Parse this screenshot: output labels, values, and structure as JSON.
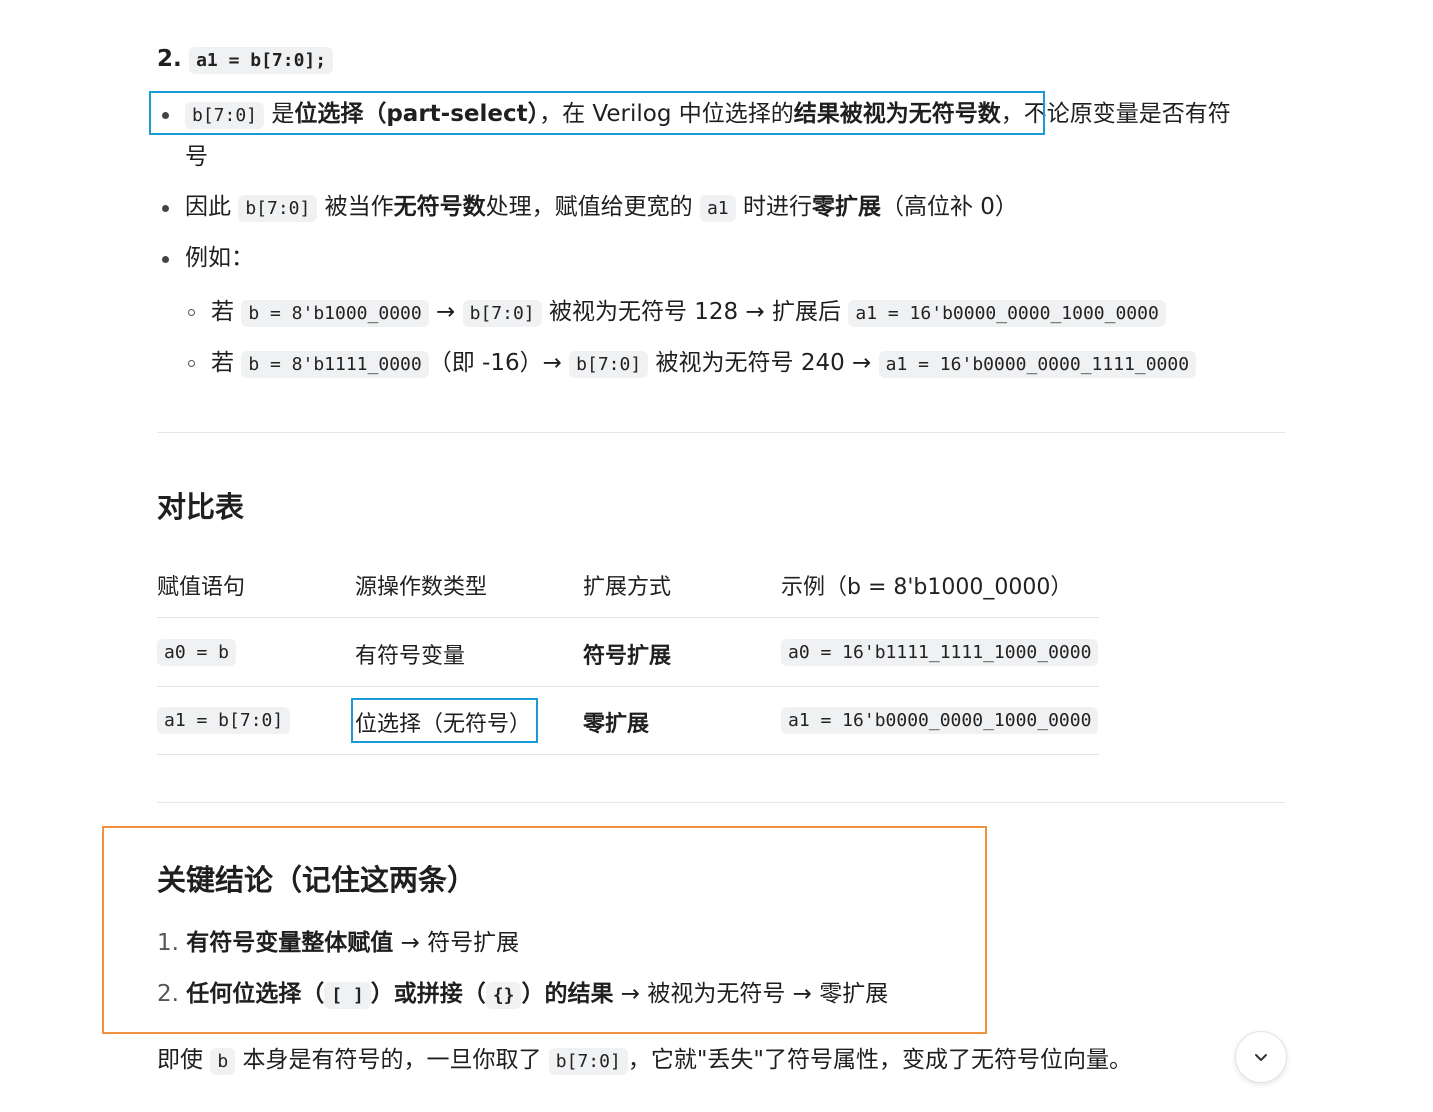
{
  "section_item2": {
    "number": "2.",
    "code": "a1 = b[7:0];"
  },
  "bullet1": {
    "code": "b[7:0]",
    "t1": " 是",
    "b1": "位选择（part-select）",
    "t2": "，在 Verilog 中位选择的",
    "b2": "结果被视为无符号数",
    "t3": "，不论原变量是否有符",
    "t4": "号"
  },
  "bullet2": {
    "t1": "因此 ",
    "code1": "b[7:0]",
    "t2": " 被当作",
    "b1": "无符号数",
    "t3": "处理，赋值给更宽的 ",
    "code2": "a1",
    "t4": " 时进行",
    "b2": "零扩展",
    "t5": "（高位补 0）"
  },
  "bullet3": {
    "label": "例如："
  },
  "sub1": {
    "t1": "若 ",
    "code1": "b = 8'b1000_0000",
    "t2": " → ",
    "code2": "b[7:0]",
    "t3": " 被视为无符号 128 → 扩展后 ",
    "code3": "a1 = 16'b0000_0000_1000_0000"
  },
  "sub2": {
    "t1": "若 ",
    "code1": "b = 8'b1111_0000",
    "t2": "（即 -16）→ ",
    "code2": "b[7:0]",
    "t3": " 被视为无符号 240 → ",
    "code3": "a1 = 16'b0000_0000_1111_0000"
  },
  "table_section": {
    "heading": "对比表",
    "headers": [
      "赋值语句",
      "源操作数类型",
      "扩展方式",
      "示例（b = 8'b1000_0000）"
    ],
    "rows": [
      [
        "a0 = b",
        "有符号变量",
        "符号扩展",
        "a0 = 16'b1111_1111_1000_0000"
      ],
      [
        "a1 = b[7:0]",
        "位选择（无符号）",
        "零扩展",
        "a1 = 16'b0000_0000_1000_0000"
      ]
    ]
  },
  "conclusion": {
    "heading": "关键结论（记住这两条）",
    "item1": {
      "num": "1.",
      "bold": "有符号变量整体赋值",
      "rest": " → 符号扩展"
    },
    "item2": {
      "num": "2.",
      "b1": "任何位选择（",
      "code1": "[ ]",
      "b2": "）或拼接（",
      "code2": "{}",
      "b3": "）的结果",
      "rest": " → 被视为无符号 → 零扩展"
    }
  },
  "final_line": {
    "t1": "即使 ",
    "code1": "b",
    "t2": " 本身是有符号的，一旦你取了 ",
    "code2": "b[7:0]",
    "t3": "，它就\"丢失\"了符号属性，变成了无符号位向量。"
  },
  "scroll_button": {
    "icon": "chevron-down-icon"
  },
  "colors": {
    "highlight_blue": "#1c9ad6",
    "highlight_orange": "#f0913f"
  }
}
